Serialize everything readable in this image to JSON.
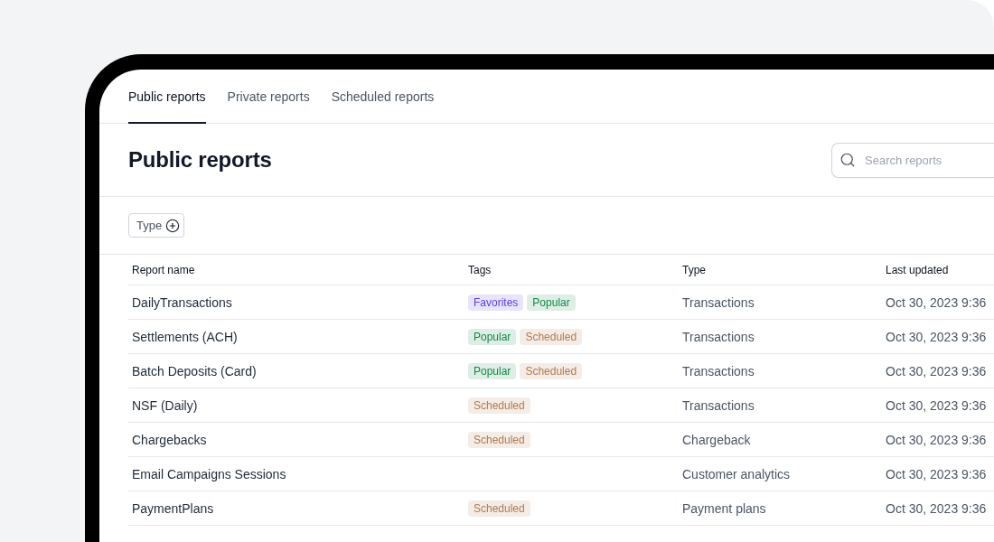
{
  "tabs": [
    {
      "label": "Public reports",
      "selected": true
    },
    {
      "label": "Private reports",
      "selected": false
    },
    {
      "label": "Scheduled reports",
      "selected": false
    }
  ],
  "page": {
    "title": "Public reports"
  },
  "search": {
    "placeholder": "Search reports"
  },
  "filters": [
    {
      "label": "Type"
    }
  ],
  "table": {
    "columns": [
      "Report name",
      "Tags",
      "Type",
      "Last updated"
    ],
    "rows": [
      {
        "name": "DailyTransactions",
        "tags": [
          {
            "label": "Favorites",
            "color": "#5b3fe0"
          },
          {
            "label": "Popular",
            "color": "#16874a"
          }
        ],
        "type": "Transactions",
        "last_updated": "Oct 30, 2023 9:36"
      },
      {
        "name": "Settlements (ACH)",
        "tags": [
          {
            "label": "Popular",
            "color": "#16874a"
          },
          {
            "label": "Scheduled",
            "color": "#b07a4e"
          }
        ],
        "type": "Transactions",
        "last_updated": "Oct 30, 2023 9:36"
      },
      {
        "name": "Batch Deposits (Card)",
        "tags": [
          {
            "label": "Popular",
            "color": "#16874a"
          },
          {
            "label": "Scheduled",
            "color": "#b07a4e"
          }
        ],
        "type": "Transactions",
        "last_updated": "Oct 30, 2023 9:36"
      },
      {
        "name": "NSF (Daily)",
        "tags": [
          {
            "label": "Scheduled",
            "color": "#b07a4e"
          }
        ],
        "type": "Transactions",
        "last_updated": "Oct 30, 2023 9:36"
      },
      {
        "name": "Chargebacks",
        "tags": [
          {
            "label": "Scheduled",
            "color": "#b07a4e"
          }
        ],
        "type": "Chargeback",
        "last_updated": "Oct 30, 2023 9:36"
      },
      {
        "name": "Email Campaigns Sessions",
        "type": "Customer analytics",
        "last_updated": "Oct 30, 2023 9:36"
      },
      {
        "name": "PaymentPlans",
        "tags": [
          {
            "label": "Scheduled",
            "color": "#b07a4e"
          }
        ],
        "type": "Payment plans",
        "last_updated": "Oct 30, 2023 9:36"
      }
    ]
  }
}
